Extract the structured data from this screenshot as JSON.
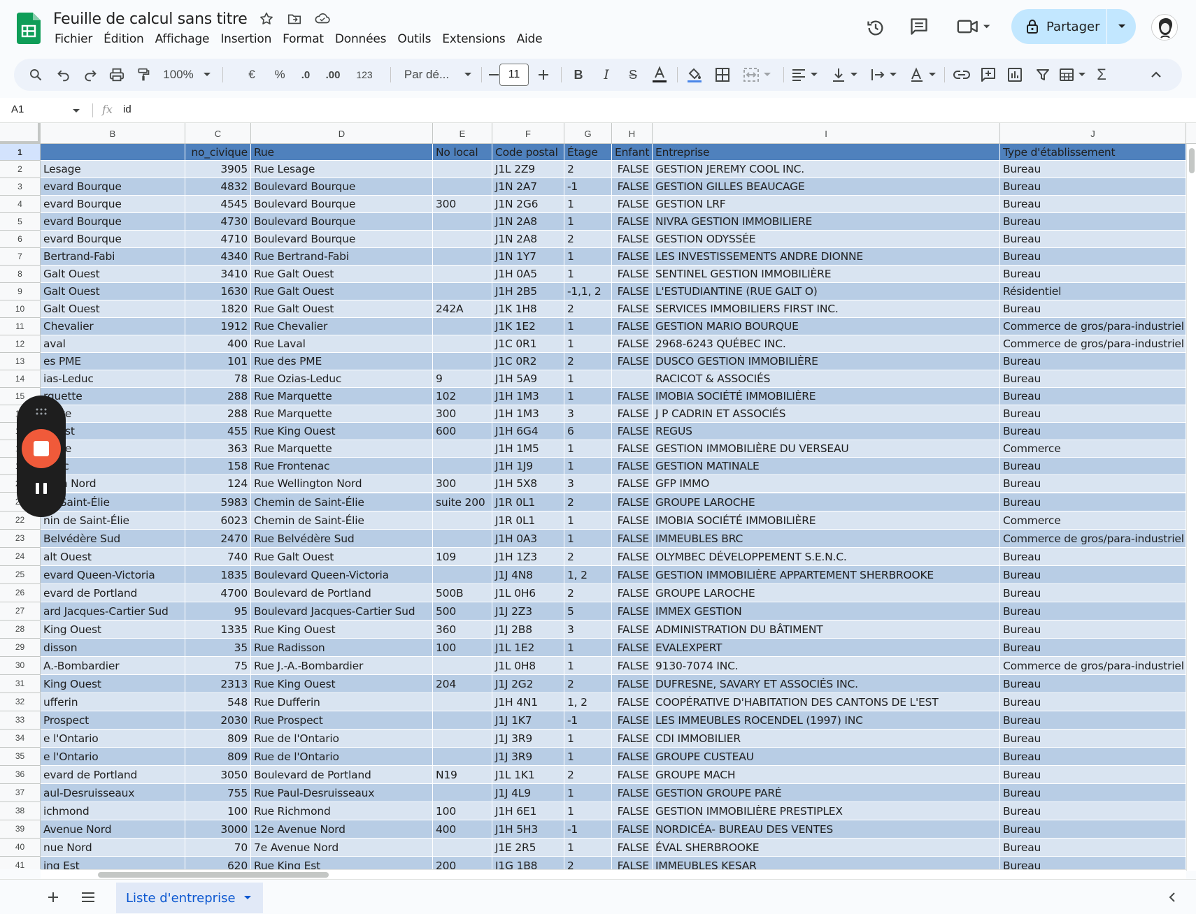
{
  "header": {
    "title": "Feuille de calcul sans titre",
    "menu": [
      "Fichier",
      "Édition",
      "Affichage",
      "Insertion",
      "Format",
      "Données",
      "Outils",
      "Extensions",
      "Aide"
    ],
    "share_label": "Partager"
  },
  "toolbar": {
    "zoom": "100%",
    "currency": "€",
    "percent": "%",
    "dec_decrease": ".0",
    "dec_increase": ".00",
    "number_format": "123",
    "font": "Par dé...",
    "font_size": "11"
  },
  "formula_bar": {
    "cell_ref": "A1",
    "fx": "fx",
    "value": "id"
  },
  "columns": [
    "B",
    "C",
    "D",
    "E",
    "F",
    "G",
    "H",
    "I",
    "J"
  ],
  "header_row": {
    "num": "1",
    "cells": [
      "",
      "no_civique",
      "Rue",
      "No local",
      "Code postal",
      "Étage",
      "Enfant",
      "Entreprise",
      "Type d'établissement"
    ]
  },
  "rows": [
    {
      "n": "2",
      "b": "Lesage",
      "c": "3905",
      "d": "Rue Lesage",
      "e": "",
      "f": "J1L 2Z9",
      "g": "2",
      "h": "FALSE",
      "i": "GESTION JEREMY COOL INC.",
      "j": "Bureau"
    },
    {
      "n": "3",
      "b": "evard Bourque",
      "c": "4832",
      "d": "Boulevard Bourque",
      "e": "",
      "f": "J1N 2A7",
      "g": "-1",
      "h": "FALSE",
      "i": "GESTION GILLES BEAUCAGE",
      "j": "Bureau"
    },
    {
      "n": "4",
      "b": "evard Bourque",
      "c": "4545",
      "d": "Boulevard Bourque",
      "e": "300",
      "f": "J1N 2G6",
      "g": "1",
      "h": "FALSE",
      "i": "GESTION LRF",
      "j": "Bureau"
    },
    {
      "n": "5",
      "b": "evard Bourque",
      "c": "4730",
      "d": "Boulevard Bourque",
      "e": "",
      "f": "J1N 2A8",
      "g": "1",
      "h": "FALSE",
      "i": "NIVRA GESTION IMMOBILIERE",
      "j": "Bureau"
    },
    {
      "n": "6",
      "b": "evard Bourque",
      "c": "4710",
      "d": "Boulevard Bourque",
      "e": "",
      "f": "J1N 2A8",
      "g": "2",
      "h": "FALSE",
      "i": "GESTION ODYSSÉE",
      "j": "Bureau"
    },
    {
      "n": "7",
      "b": "Bertrand-Fabi",
      "c": "4340",
      "d": "Rue Bertrand-Fabi",
      "e": "",
      "f": "J1N 1Y7",
      "g": "1",
      "h": "FALSE",
      "i": "LES INVESTISSEMENTS ANDRE DIONNE",
      "j": "Bureau"
    },
    {
      "n": "8",
      "b": "Galt Ouest",
      "c": "3410",
      "d": "Rue Galt Ouest",
      "e": "",
      "f": "J1H 0A5",
      "g": "1",
      "h": "FALSE",
      "i": "SENTINEL GESTION IMMOBILIÈRE",
      "j": "Bureau"
    },
    {
      "n": "9",
      "b": "Galt Ouest",
      "c": "1630",
      "d": "Rue Galt Ouest",
      "e": "",
      "f": "J1H 2B5",
      "g": "-1,1, 2",
      "h": "FALSE",
      "i": "L'ESTUDIANTINE (RUE GALT O)",
      "j": "Résidentiel"
    },
    {
      "n": "10",
      "b": "Galt Ouest",
      "c": "1820",
      "d": "Rue Galt Ouest",
      "e": "242A",
      "f": "J1K 1H8",
      "g": "2",
      "h": "FALSE",
      "i": "SERVICES IMMOBILIERS FIRST INC.",
      "j": "Bureau"
    },
    {
      "n": "11",
      "b": "Chevalier",
      "c": "1912",
      "d": "Rue Chevalier",
      "e": "",
      "f": "J1K 1E2",
      "g": "1",
      "h": "FALSE",
      "i": "GESTION MARIO BOURQUE",
      "j": "Commerce de gros/para-industriel"
    },
    {
      "n": "12",
      "b": "aval",
      "c": "400",
      "d": "Rue Laval",
      "e": "",
      "f": "J1C 0R1",
      "g": "1",
      "h": "FALSE",
      "i": "2968-6243 QUÉBEC INC.",
      "j": "Commerce de gros/para-industriel"
    },
    {
      "n": "13",
      "b": "es PME",
      "c": "101",
      "d": "Rue des PME",
      "e": "",
      "f": "J1C 0R2",
      "g": "2",
      "h": "FALSE",
      "i": "DUSCO GESTION IMMOBILIÈRE",
      "j": "Bureau"
    },
    {
      "n": "14",
      "b": "ias-Leduc",
      "c": "78",
      "d": "Rue Ozias-Leduc",
      "e": "9",
      "f": "J1H 5A9",
      "g": "1",
      "h": "",
      "i": "RACICOT & ASSOCIÉS",
      "j": "Bureau"
    },
    {
      "n": "15",
      "b": "rquette",
      "c": "288",
      "d": "Rue Marquette",
      "e": "102",
      "f": "J1H 1M3",
      "g": "1",
      "h": "FALSE",
      "i": "IMOBIA SOCIÉTÉ IMMOBILIÈRE",
      "j": "Bureau"
    },
    {
      "n": "16",
      "b": "uette",
      "c": "288",
      "d": "Rue Marquette",
      "e": "300",
      "f": "J1H 1M3",
      "g": "3",
      "h": "FALSE",
      "i": "J P CADRIN ET ASSOCIÉS",
      "j": "Bureau"
    },
    {
      "n": "17",
      "b": "Ouest",
      "c": "455",
      "d": "Rue King Ouest",
      "e": "600",
      "f": "J1H 6G4",
      "g": "6",
      "h": "FALSE",
      "i": "REGUS",
      "j": "Bureau"
    },
    {
      "n": "18",
      "b": "uette",
      "c": "363",
      "d": "Rue Marquette",
      "e": "",
      "f": "J1H 1M5",
      "g": "1",
      "h": "FALSE",
      "i": "GESTION IMMOBILIÈRE DU VERSEAU",
      "j": "Commerce"
    },
    {
      "n": "19",
      "b": "enac",
      "c": "158",
      "d": "Rue Frontenac",
      "e": "",
      "f": "J1H 1J9",
      "g": "1",
      "h": "FALSE",
      "i": "GESTION MATINALE",
      "j": "Bureau"
    },
    {
      "n": "20",
      "b": "gton Nord",
      "c": "124",
      "d": "Rue Wellington Nord",
      "e": "300",
      "f": "J1H 5X8",
      "g": "3",
      "h": "FALSE",
      "i": "GFP IMMO",
      "j": "Bureau"
    },
    {
      "n": "21",
      "b": "de Saint-Élie",
      "c": "5983",
      "d": "Chemin de Saint-Élie",
      "e": "suite 200",
      "f": "J1R 0L1",
      "g": "2",
      "h": "FALSE",
      "i": "GROUPE LAROCHE",
      "j": "Bureau"
    },
    {
      "n": "22",
      "b": "nin de Saint-Élie",
      "c": "6023",
      "d": "Chemin de Saint-Élie",
      "e": "",
      "f": "J1R 0L1",
      "g": "1",
      "h": "FALSE",
      "i": "IMOBIA SOCIÉTÉ IMMOBILIÈRE",
      "j": "Commerce"
    },
    {
      "n": "23",
      "b": "Belvédère Sud",
      "c": "2470",
      "d": "Rue Belvédère Sud",
      "e": "",
      "f": "J1H 0A3",
      "g": "1",
      "h": "FALSE",
      "i": "IMMEUBLES BRC",
      "j": "Commerce de gros/para-industriel"
    },
    {
      "n": "24",
      "b": "alt Ouest",
      "c": "740",
      "d": "Rue Galt Ouest",
      "e": "109",
      "f": "J1H 1Z3",
      "g": "2",
      "h": "FALSE",
      "i": "OLYMBEC DÉVELOPPEMENT S.E.N.C.",
      "j": "Bureau"
    },
    {
      "n": "25",
      "b": "evard Queen-Victoria",
      "c": "1835",
      "d": "Boulevard Queen-Victoria",
      "e": "",
      "f": "J1J 4N8",
      "g": "1, 2",
      "h": "FALSE",
      "i": "GESTION IMMOBILIÈRE APPARTEMENT SHERBROOKE",
      "j": "Bureau"
    },
    {
      "n": "26",
      "b": "evard de Portland",
      "c": "4700",
      "d": "Boulevard de Portland",
      "e": "500B",
      "f": "J1L 0H6",
      "g": "2",
      "h": "FALSE",
      "i": "GROUPE LAROCHE",
      "j": "Bureau"
    },
    {
      "n": "27",
      "b": "ard Jacques-Cartier Sud",
      "c": "95",
      "d": "Boulevard Jacques-Cartier Sud",
      "e": "500",
      "f": "J1J 2Z3",
      "g": "5",
      "h": "FALSE",
      "i": "IMMEX GESTION",
      "j": "Bureau"
    },
    {
      "n": "28",
      "b": "King Ouest",
      "c": "1335",
      "d": "Rue King Ouest",
      "e": "360",
      "f": "J1J 2B8",
      "g": "3",
      "h": "FALSE",
      "i": "ADMINISTRATION DU BÂTIMENT",
      "j": "Bureau"
    },
    {
      "n": "29",
      "b": "disson",
      "c": "35",
      "d": "Rue Radisson",
      "e": "100",
      "f": "J1L 1E2",
      "g": "1",
      "h": "FALSE",
      "i": "EVALEXPERT",
      "j": "Bureau"
    },
    {
      "n": "30",
      "b": "A.-Bombardier",
      "c": "75",
      "d": "Rue J.-A.-Bombardier",
      "e": "",
      "f": "J1L 0H8",
      "g": "1",
      "h": "FALSE",
      "i": "9130-7074 INC.",
      "j": "Commerce de gros/para-industriel"
    },
    {
      "n": "31",
      "b": "King Ouest",
      "c": "2313",
      "d": "Rue King Ouest",
      "e": "204",
      "f": "J1J 2G2",
      "g": "2",
      "h": "FALSE",
      "i": "DUFRESNE, SAVARY ET ASSOCIÉS INC.",
      "j": "Bureau"
    },
    {
      "n": "32",
      "b": "ufferin",
      "c": "548",
      "d": "Rue Dufferin",
      "e": "",
      "f": "J1H 4N1",
      "g": "1, 2",
      "h": "FALSE",
      "i": "COOPÉRATIVE D'HABITATION DES CANTONS DE L'EST",
      "j": "Bureau"
    },
    {
      "n": "33",
      "b": "Prospect",
      "c": "2030",
      "d": "Rue Prospect",
      "e": "",
      "f": "J1J 1K7",
      "g": "-1",
      "h": "FALSE",
      "i": "LES IMMEUBLES ROCENDEL (1997) INC",
      "j": "Bureau"
    },
    {
      "n": "34",
      "b": "e l'Ontario",
      "c": "809",
      "d": "Rue de l'Ontario",
      "e": "",
      "f": "J1J 3R9",
      "g": "1",
      "h": "FALSE",
      "i": "CDI IMMOBILIER",
      "j": "Bureau"
    },
    {
      "n": "35",
      "b": "e l'Ontario",
      "c": "809",
      "d": "Rue de l'Ontario",
      "e": "",
      "f": "J1J 3R9",
      "g": "1",
      "h": "FALSE",
      "i": "GROUPE CUSTEAU",
      "j": "Bureau"
    },
    {
      "n": "36",
      "b": "evard de Portland",
      "c": "3050",
      "d": "Boulevard de Portland",
      "e": "N19",
      "f": "J1L 1K1",
      "g": "2",
      "h": "FALSE",
      "i": "GROUPE MACH",
      "j": "Bureau"
    },
    {
      "n": "37",
      "b": "aul-Desruisseaux",
      "c": "755",
      "d": "Rue Paul-Desruisseaux",
      "e": "",
      "f": "J1J 4L9",
      "g": "1",
      "h": "FALSE",
      "i": "GESTION GROUPE PARÉ",
      "j": "Bureau"
    },
    {
      "n": "38",
      "b": "ichmond",
      "c": "100",
      "d": "Rue Richmond",
      "e": "100",
      "f": "J1H 6E1",
      "g": "1",
      "h": "FALSE",
      "i": "GESTION IMMOBILIÈRE PRESTIPLEX",
      "j": "Bureau"
    },
    {
      "n": "39",
      "b": "Avenue Nord",
      "c": "3000",
      "d": "12e Avenue Nord",
      "e": "400",
      "f": "J1H 5H3",
      "g": "-1",
      "h": "FALSE",
      "i": "NORDICÉA- BUREAU DES VENTES",
      "j": "Bureau"
    },
    {
      "n": "40",
      "b": "nue Nord",
      "c": "70",
      "d": "7e Avenue Nord",
      "e": "",
      "f": "J1E 2R5",
      "g": "1",
      "h": "FALSE",
      "i": "ÉVAL SHERBROOKE",
      "j": "Bureau"
    },
    {
      "n": "41",
      "b": "ing Est",
      "c": "620",
      "d": "Rue King Est",
      "e": "200",
      "f": "J1G 1B8",
      "g": "2",
      "h": "FALSE",
      "i": "IMMEUBLES KESAR",
      "j": "Bureau"
    }
  ],
  "sheet_tab": "Liste d'entreprise",
  "colors": {
    "header_fill": "#4f81bd",
    "band_light": "#d9e4f1",
    "band_dark": "#b8cde5",
    "share_bg": "#c2e7ff",
    "record_red": "#f05a3a"
  }
}
